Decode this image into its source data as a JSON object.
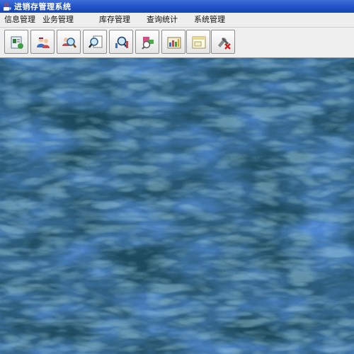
{
  "window": {
    "title": "进销存管理系统",
    "app_icon": "java-cup-icon"
  },
  "menu": [
    {
      "label": "信息管理"
    },
    {
      "label": "业务管理"
    },
    {
      "label": "库存管理"
    },
    {
      "label": "查询统计"
    },
    {
      "label": "系统管理"
    }
  ],
  "toolbar": [
    {
      "icon": "info-card-icon"
    },
    {
      "icon": "users-icon"
    },
    {
      "icon": "user-search-icon"
    },
    {
      "icon": "document-search-icon"
    },
    {
      "icon": "chart-search-icon"
    },
    {
      "icon": "inventory-search-icon"
    },
    {
      "icon": "report-icon"
    },
    {
      "icon": "window-icon"
    },
    {
      "icon": "tools-exit-icon"
    }
  ],
  "colors": {
    "title_bar": "#2052c6",
    "desktop": "#1d4a5e"
  }
}
